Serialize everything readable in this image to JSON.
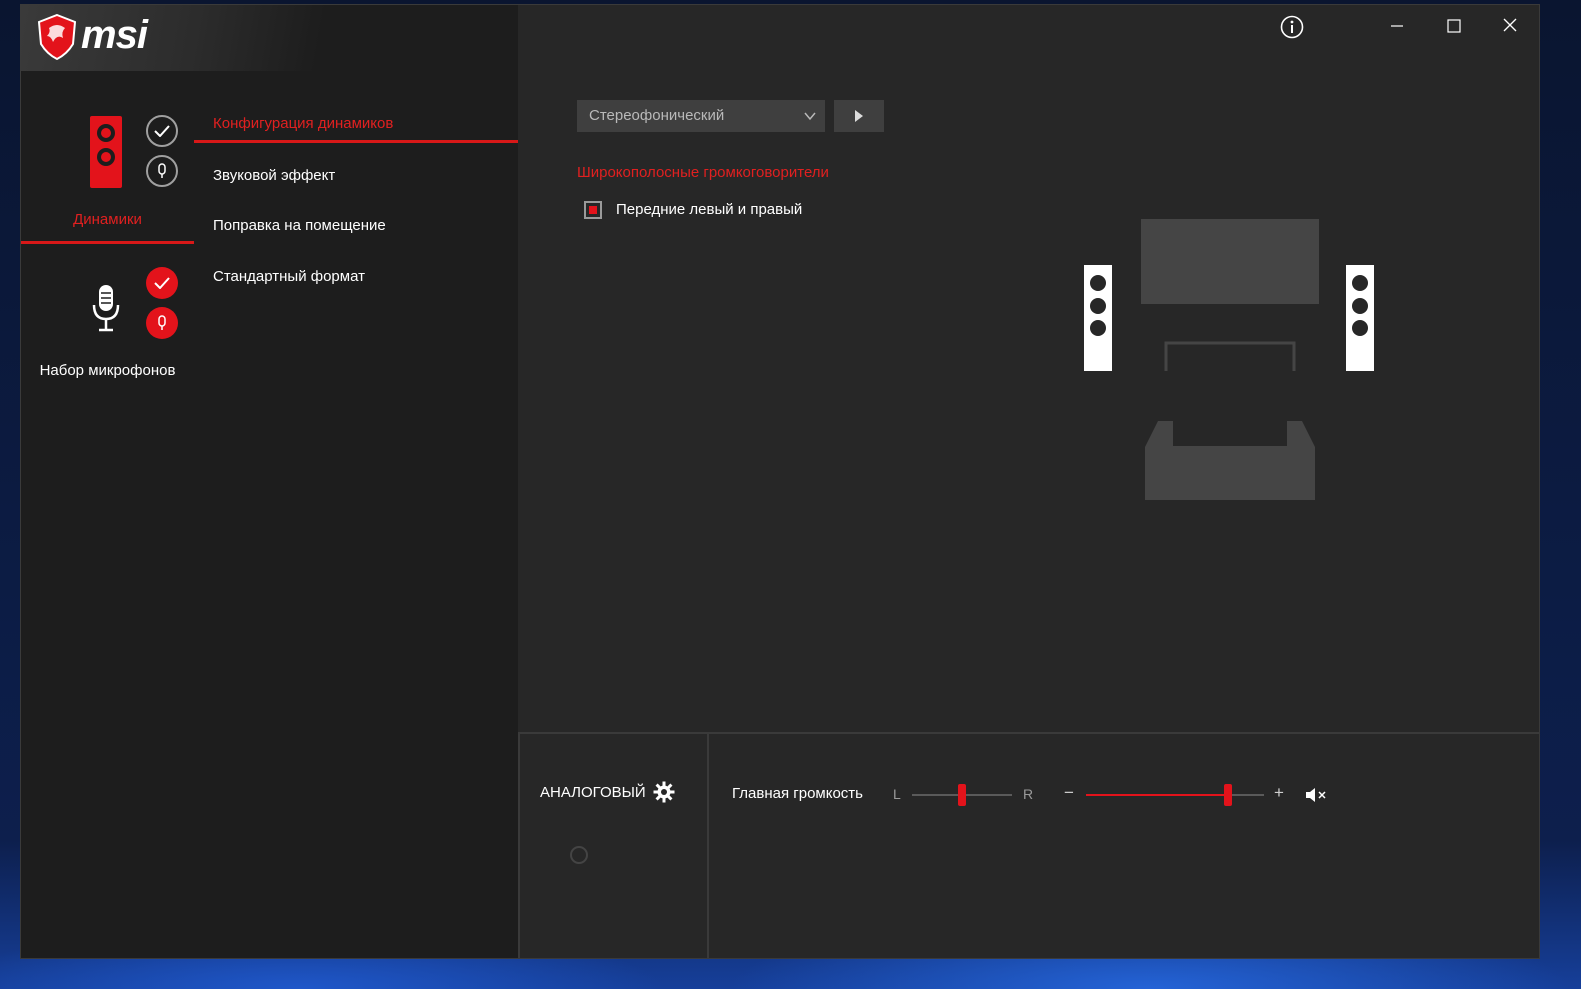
{
  "window": {
    "logo_text": "msi",
    "controls": {
      "info": "info-icon",
      "minimize": "minimize-icon",
      "maximize": "maximize-icon",
      "close": "close-icon"
    }
  },
  "devices": {
    "speakers": {
      "label": "Динамики",
      "status_check": "check-icon",
      "status_mic": "mic-icon"
    },
    "microphones": {
      "label": "Набор микрофонов",
      "status_check": "check-icon",
      "status_mic": "mic-icon"
    }
  },
  "menu": {
    "items": [
      {
        "label": "Конфигурация динамиков",
        "active": true
      },
      {
        "label": "Звуковой эффект",
        "active": false
      },
      {
        "label": "Поправка на помещение",
        "active": false
      },
      {
        "label": "Стандартный формат",
        "active": false
      }
    ]
  },
  "config": {
    "speaker_mode_value": "Стереофонический",
    "section_title": "Широкополосные громкоговорители",
    "checkbox_label": "Передние левый и правый",
    "checkbox_checked": true
  },
  "bottom": {
    "connector_label": "АНАЛОГОВЫЙ",
    "volume_label": "Главная громкость",
    "balance_left": "L",
    "balance_right": "R",
    "volume_minus": "−",
    "volume_plus": "+",
    "balance_level": 0.5,
    "volume_level": 0.8,
    "muted": false
  },
  "colors": {
    "accent": "#e3131b",
    "bg": "#272727",
    "sidebar": "#1d1d1d"
  }
}
